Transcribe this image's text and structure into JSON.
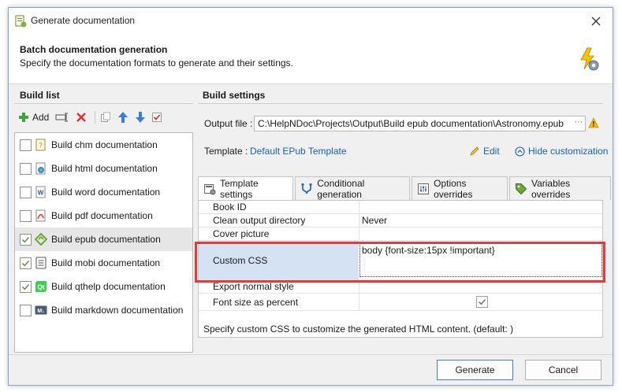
{
  "window": {
    "title": "Generate documentation"
  },
  "header": {
    "title": "Batch documentation generation",
    "subtitle": "Specify the documentation formats to generate and their settings."
  },
  "build_list": {
    "section_title": "Build list",
    "toolbar": {
      "add_label": "Add"
    },
    "items": [
      {
        "label": "Build chm documentation",
        "checked": false,
        "icon": "chm-icon"
      },
      {
        "label": "Build html documentation",
        "checked": false,
        "icon": "html-icon"
      },
      {
        "label": "Build word documentation",
        "checked": false,
        "icon": "word-icon"
      },
      {
        "label": "Build pdf documentation",
        "checked": false,
        "icon": "pdf-icon"
      },
      {
        "label": "Build epub documentation",
        "checked": true,
        "icon": "epub-icon",
        "selected": true
      },
      {
        "label": "Build mobi documentation",
        "checked": true,
        "icon": "mobi-icon"
      },
      {
        "label": "Build qthelp documentation",
        "checked": true,
        "icon": "qthelp-icon"
      },
      {
        "label": "Build markdown documentation",
        "checked": false,
        "icon": "markdown-icon"
      }
    ]
  },
  "build_settings": {
    "section_title": "Build settings",
    "output_label": "Output file :",
    "output_value": "C:\\HelpNDoc\\Projects\\Output\\Build epub documentation\\Astronomy.epub",
    "ellipsis": "···",
    "template_label": "Template :",
    "template_value": "Default EPub Template",
    "edit_label": "Edit",
    "hide_label": "Hide customization",
    "tabs": [
      {
        "label": "Template settings",
        "active": true
      },
      {
        "label": "Conditional generation",
        "active": false
      },
      {
        "label": "Options overrides",
        "active": false
      },
      {
        "label": "Variables overrides",
        "active": false
      }
    ],
    "properties": {
      "book_id": {
        "name": "Book ID",
        "value": ""
      },
      "clean_output": {
        "name": "Clean output directory",
        "value": "Never"
      },
      "cover_picture": {
        "name": "Cover picture",
        "value": ""
      },
      "custom_css": {
        "name": "Custom CSS",
        "value": "body {font-size:15px !important}"
      },
      "export_normal": {
        "name": "Export normal style",
        "checked": false
      },
      "font_size_percent": {
        "name": "Font size as percent",
        "checked": true
      }
    },
    "description": "Specify custom CSS to customize the generated HTML content. (default: )"
  },
  "footer": {
    "generate_label": "Generate",
    "cancel_label": "Cancel"
  },
  "colors": {
    "accent": "#1a5fb4",
    "highlight": "#e23b3b",
    "selected_row": "#d5e2f4"
  }
}
